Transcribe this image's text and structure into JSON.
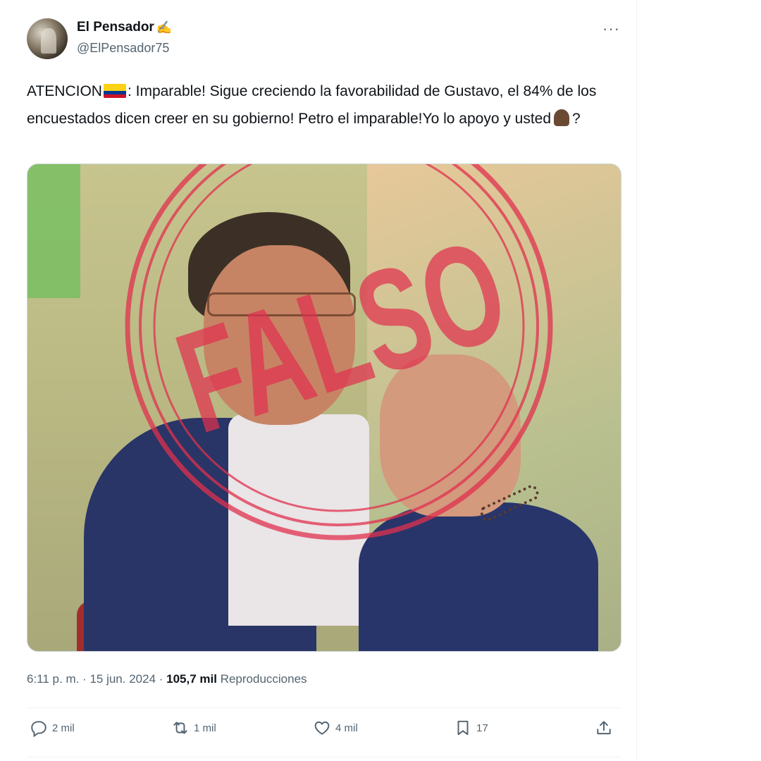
{
  "author": {
    "display_name": "El Pensador",
    "name_emoji": "✍",
    "handle": "@ElPensador75"
  },
  "menu_icon": "more-dots-icon",
  "tweet": {
    "text_part1": "ATENCION",
    "flag_icon": "colombia-flag-icon",
    "text_part2": ": Imparable! Sigue creciendo la favorabilidad de Gustavo, el 84% de los encuestados dicen creer en su gobierno! Petro el imparable!Yo lo apoyo y usted",
    "pointing_icon": "pointing-down-icon",
    "text_part3": "?"
  },
  "media": {
    "stamp_text": "FALSO",
    "stamp_color": "#e0304e"
  },
  "meta": {
    "time_date": "6:11 p. m. · 15 jun. 2024 · ",
    "views_count": "105,7 mil",
    "views_label": " Reproducciones"
  },
  "actions": {
    "replies": "2 mil",
    "reposts": "1 mil",
    "likes": "4 mil",
    "bookmarks": "17"
  },
  "colors": {
    "text": "#0f1419",
    "secondary": "#536471",
    "divider": "#eff3f4"
  }
}
